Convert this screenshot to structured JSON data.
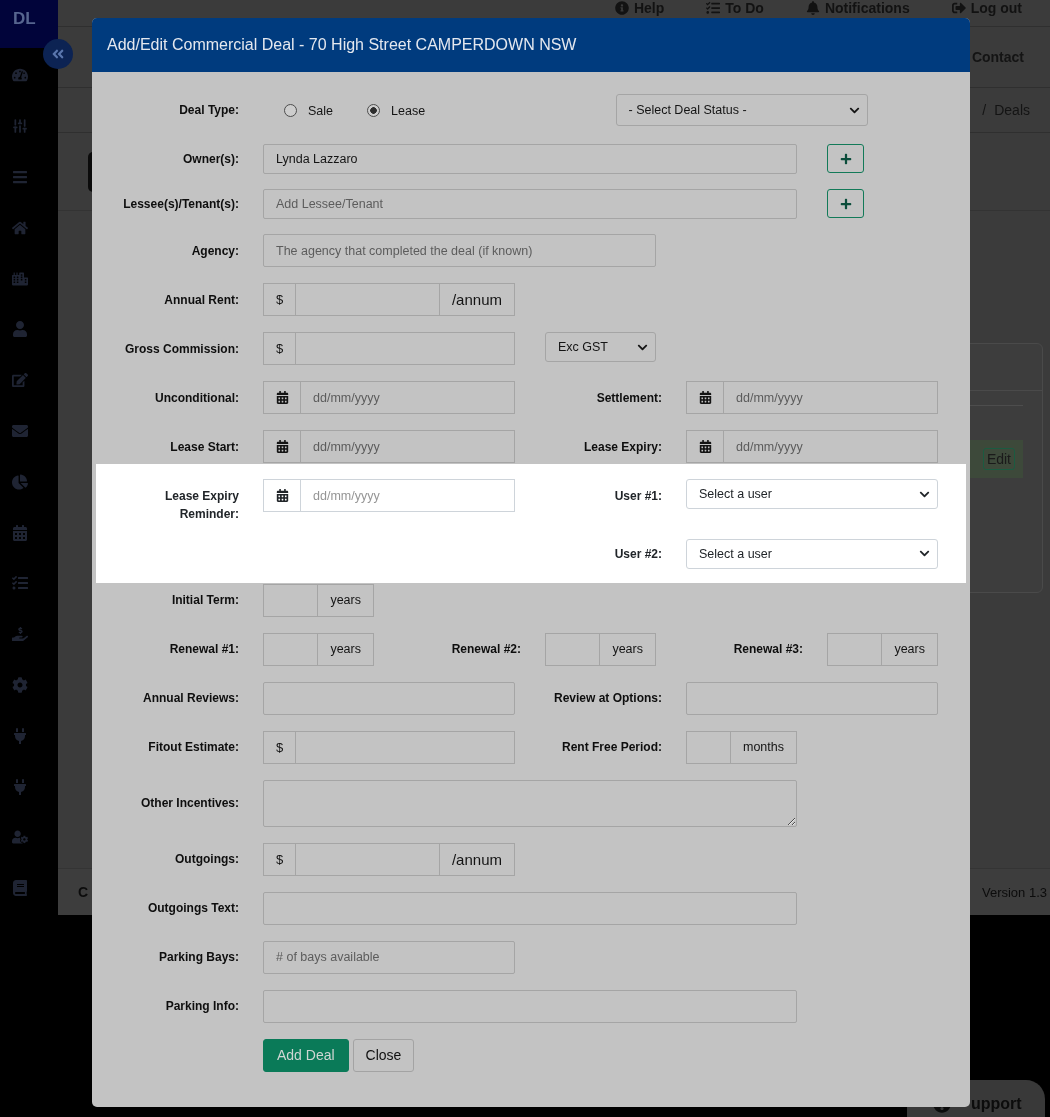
{
  "sidebar": {
    "logo": "DL"
  },
  "top_nav": [
    {
      "label": "Help"
    },
    {
      "label": "To Do"
    },
    {
      "label": "Notifications"
    },
    {
      "label": "Log out"
    }
  ],
  "main_nav": [
    {
      "label": "Contact"
    }
  ],
  "breadcrumb": {
    "separator": "/",
    "items": [
      "Deals"
    ]
  },
  "deals_card": {
    "row_action": "Edit"
  },
  "footer": {
    "left_text": "C",
    "version": "Version 1.3"
  },
  "support_button": {
    "label": "upport"
  },
  "dialog": {
    "title": "Add/Edit Commercial Deal - 70 High Street CAMPERDOWN NSW",
    "rows": [
      {
        "highlighted": false,
        "fields": [
          {
            "kind": "radios",
            "label": "Deal Type:",
            "options": [
              {
                "label": "Sale",
                "selected": false
              },
              {
                "label": "Lease",
                "selected": true
              }
            ]
          },
          {
            "kind": "select",
            "value": "- Select Deal Status -"
          }
        ]
      },
      {
        "highlighted": false,
        "fields": [
          {
            "kind": "text",
            "label": "Owner(s):",
            "value": "Lynda Lazzaro",
            "add_button": true
          }
        ]
      },
      {
        "highlighted": false,
        "fields": [
          {
            "kind": "text",
            "label": "Lessee(s)/Tenant(s):",
            "placeholder": "Add Lessee/Tenant",
            "add_button": true
          }
        ]
      },
      {
        "highlighted": false,
        "fields": [
          {
            "kind": "text",
            "label": "Agency:",
            "placeholder": "The agency that completed the deal (if known)"
          }
        ]
      },
      {
        "highlighted": false,
        "fields": [
          {
            "kind": "addon",
            "label": "Annual Rent:",
            "prefix": "$",
            "suffix": "/annum"
          }
        ]
      },
      {
        "highlighted": false,
        "fields": [
          {
            "kind": "addon",
            "label": "Gross Commission:",
            "prefix": "$"
          },
          {
            "kind": "select",
            "value": "Exc GST"
          }
        ]
      },
      {
        "highlighted": false,
        "fields": [
          {
            "kind": "date",
            "label": "Unconditional:",
            "placeholder": "dd/mm/yyyy"
          },
          {
            "kind": "date",
            "label": "Settlement:",
            "placeholder": "dd/mm/yyyy"
          }
        ]
      },
      {
        "highlighted": false,
        "fields": [
          {
            "kind": "date",
            "label": "Lease Start:",
            "placeholder": "dd/mm/yyyy"
          },
          {
            "kind": "date",
            "label": "Lease Expiry:",
            "placeholder": "dd/mm/yyyy"
          }
        ]
      },
      {
        "highlighted": true,
        "fields": [
          {
            "kind": "date",
            "label": "Lease Expiry Reminder:",
            "placeholder": "dd/mm/yyyy"
          },
          {
            "kind": "select",
            "label": "User #1:",
            "value": "Select a user"
          }
        ]
      },
      {
        "highlighted": true,
        "fields": [
          {
            "kind": "select",
            "label": "User #2:",
            "value": "Select a user"
          }
        ]
      },
      {
        "highlighted": false,
        "fields": [
          {
            "kind": "addon",
            "label": "Initial Term:",
            "suffix": "years"
          }
        ]
      },
      {
        "highlighted": false,
        "fields": [
          {
            "kind": "addon",
            "label": "Renewal #1:",
            "suffix": "years"
          },
          {
            "kind": "addon",
            "label": "Renewal #2:",
            "suffix": "years"
          },
          {
            "kind": "addon",
            "label": "Renewal #3:",
            "suffix": "years"
          }
        ]
      },
      {
        "highlighted": false,
        "fields": [
          {
            "kind": "text",
            "label": "Annual Reviews:"
          },
          {
            "kind": "text",
            "label": "Review at Options:"
          }
        ]
      },
      {
        "highlighted": false,
        "fields": [
          {
            "kind": "addon",
            "label": "Fitout Estimate:",
            "prefix": "$"
          },
          {
            "kind": "addon",
            "label": "Rent Free Period:",
            "suffix": "months"
          }
        ]
      },
      {
        "highlighted": false,
        "fields": [
          {
            "kind": "textarea",
            "label": "Other Incentives:"
          }
        ]
      },
      {
        "highlighted": false,
        "fields": [
          {
            "kind": "addon",
            "label": "Outgoings:",
            "prefix": "$",
            "suffix": "/annum"
          }
        ]
      },
      {
        "highlighted": false,
        "fields": [
          {
            "kind": "text",
            "label": "Outgoings Text:"
          }
        ]
      },
      {
        "highlighted": false,
        "fields": [
          {
            "kind": "text",
            "label": "Parking Bays:",
            "placeholder": "# of bays available"
          }
        ]
      },
      {
        "highlighted": false,
        "fields": [
          {
            "kind": "text",
            "label": "Parking Info:"
          }
        ]
      }
    ],
    "buttons": [
      {
        "label": "Add Deal",
        "kind": "primary"
      },
      {
        "label": "Close",
        "kind": "secondary"
      }
    ]
  }
}
